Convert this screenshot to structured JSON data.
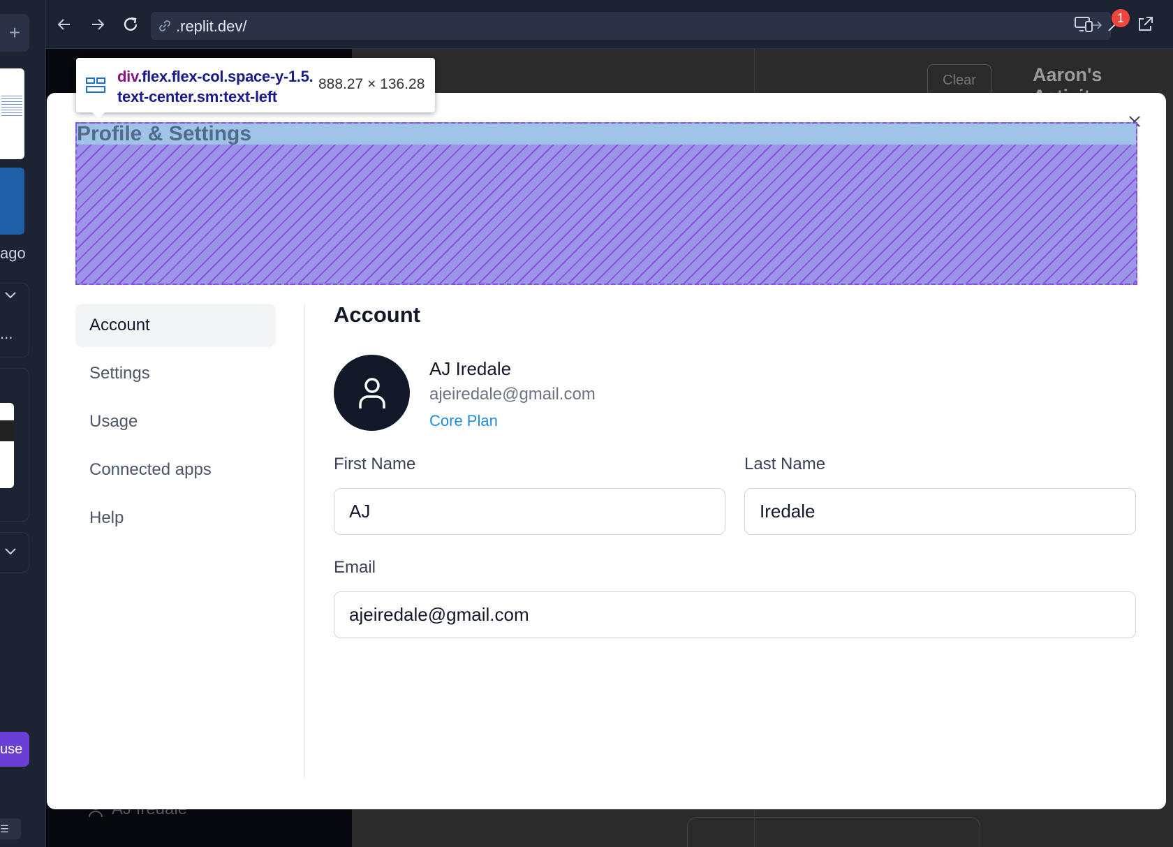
{
  "browser": {
    "url": ".replit.dev/",
    "notification_count": "1"
  },
  "left_strip": {
    "ago_text": "ago",
    "truncated_text": "...",
    "use_button": "use"
  },
  "background_app": {
    "activity_title": "Aaron's Activity",
    "clear_button": "Clear",
    "user_name": "AJ Iredale"
  },
  "devtools": {
    "selector_tag": "div",
    "selector_classes_line1": ".flex.flex-col.space-y-1.5.",
    "selector_classes_line2": "text-center.sm:text-left",
    "dimensions": "888.27 × 136.28"
  },
  "modal": {
    "title": "Profile & Settings",
    "nav": [
      {
        "label": "Account",
        "active": true
      },
      {
        "label": "Settings",
        "active": false
      },
      {
        "label": "Usage",
        "active": false
      },
      {
        "label": "Connected apps",
        "active": false
      },
      {
        "label": "Help",
        "active": false
      }
    ],
    "account": {
      "section_title": "Account",
      "name": "AJ Iredale",
      "email": "ajeiredale@gmail.com",
      "plan": "Core Plan",
      "first_name_label": "First Name",
      "first_name_value": "AJ",
      "last_name_label": "Last Name",
      "last_name_value": "Iredale",
      "email_label": "Email",
      "email_value": "ajeiredale@gmail.com"
    }
  },
  "colors": {
    "accent_link": "#1d8ce0",
    "avatar_bg": "#111827",
    "highlight_overlay": "#9a95e6",
    "badge": "#f0453a"
  },
  "icons": [
    "plus-icon",
    "back-arrow-icon",
    "forward-arrow-icon",
    "reload-icon",
    "link-icon",
    "go-arrow-icon",
    "devices-icon",
    "wrench-icon",
    "external-link-icon",
    "close-icon",
    "user-icon",
    "grid-icon",
    "chevron-down-icon"
  ]
}
